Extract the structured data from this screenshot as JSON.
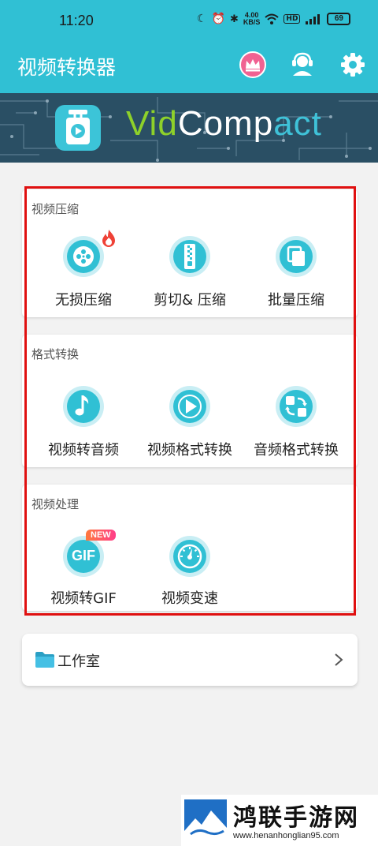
{
  "status_bar": {
    "time": "11:20",
    "net_speed": "4.00",
    "net_unit": "KB/S",
    "battery": "69",
    "icons": [
      "moon-icon",
      "alarm-icon",
      "bluetooth-icon",
      "wifi-icon",
      "hd-icon",
      "signal-icon",
      "battery-icon"
    ]
  },
  "app_bar": {
    "title": "视频转换器",
    "actions": [
      "crown-icon",
      "support-icon",
      "gear-icon"
    ]
  },
  "banner": {
    "logo_vid": "Vid",
    "logo_comp": "Comp",
    "logo_act": "act"
  },
  "sections": [
    {
      "title": "视频压缩",
      "items": [
        {
          "label": "无损压缩",
          "icon": "film-reel-icon",
          "badge": "fire-icon"
        },
        {
          "label": "剪切& 压缩",
          "icon": "zip-icon"
        },
        {
          "label": "批量压缩",
          "icon": "stack-icon"
        }
      ]
    },
    {
      "title": "格式转换",
      "items": [
        {
          "label": "视频转音频",
          "icon": "music-note-icon"
        },
        {
          "label": "视频格式转换",
          "icon": "play-icon"
        },
        {
          "label": "音频格式转换",
          "icon": "convert-icon"
        }
      ]
    },
    {
      "title": "视频处理",
      "items": [
        {
          "label": "视频转GIF",
          "icon": "gif-icon",
          "badge_text": "NEW",
          "icon_text": "GIF"
        },
        {
          "label": "视频变速",
          "icon": "speedometer-icon"
        }
      ]
    }
  ],
  "studio": {
    "label": "工作室",
    "icon": "folder-icon",
    "chevron": "chevron-right-icon"
  },
  "watermark": {
    "title": "鸿联手游网",
    "url": "www.henanhonglian95.com"
  },
  "colors": {
    "brand": "#30c0d4",
    "icon_circle": "#30c0d4",
    "highlight": "#e01010"
  }
}
